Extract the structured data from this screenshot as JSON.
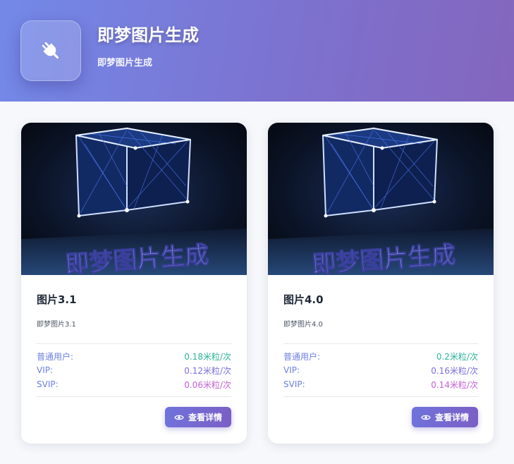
{
  "header": {
    "icon": "plug-icon",
    "title": "即梦图片生成",
    "subtitle": "即梦图片生成"
  },
  "cards": [
    {
      "image_caption": "即梦图片生成",
      "title": "图片3.1",
      "description": "即梦图片3.1",
      "prices": [
        {
          "label": "普通用户:",
          "value": "0.18米粒/次"
        },
        {
          "label": "VIP:",
          "value": "0.12米粒/次"
        },
        {
          "label": "SVIP:",
          "value": "0.06米粒/次"
        }
      ],
      "button_label": "查看详情",
      "button_icon": "eye-icon"
    },
    {
      "image_caption": "即梦图片生成",
      "title": "图片4.0",
      "description": "即梦图片4.0",
      "prices": [
        {
          "label": "普通用户:",
          "value": "0.2米粒/次"
        },
        {
          "label": "VIP:",
          "value": "0.16米粒/次"
        },
        {
          "label": "SVIP:",
          "value": "0.14米粒/次"
        }
      ],
      "button_label": "查看详情",
      "button_icon": "eye-icon"
    }
  ],
  "colors": {
    "header_gradient_start": "#7389e8",
    "header_gradient_end": "#8466bd",
    "price_label": "#6b7fe3",
    "price_normal": "#2bb39a",
    "price_vip": "#7a6ee0",
    "price_svip": "#c65ed8"
  }
}
